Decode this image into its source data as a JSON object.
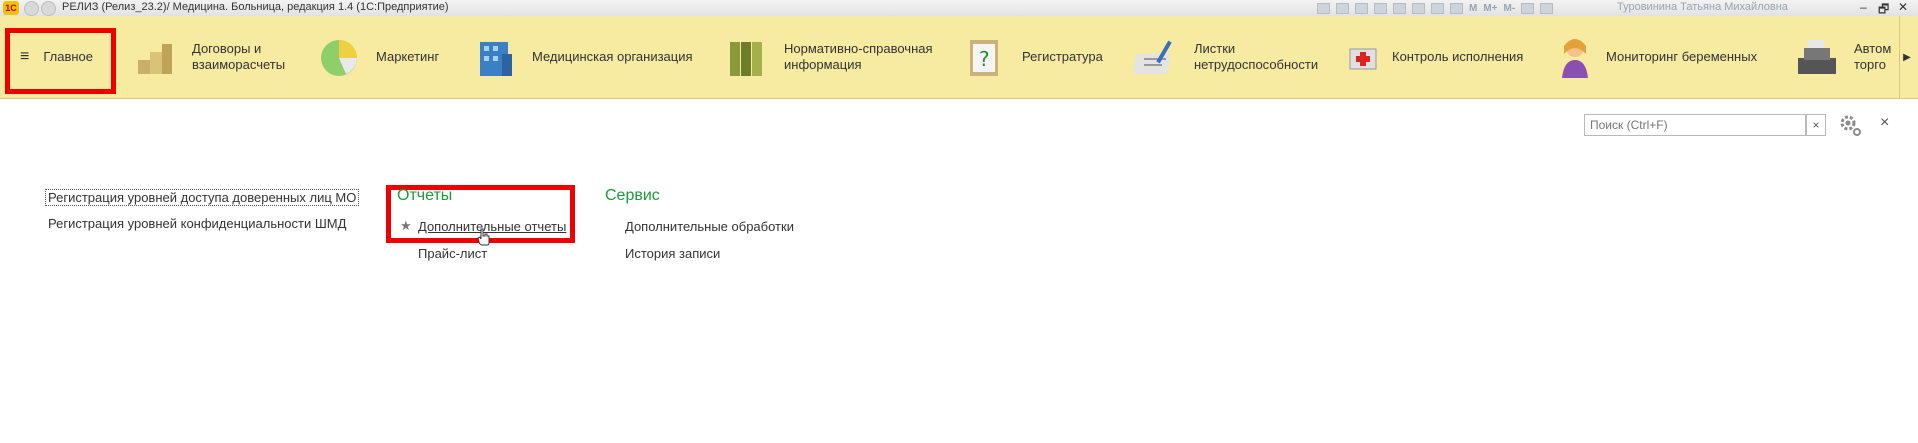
{
  "titlebar": {
    "logo": "1С",
    "title": "РЕЛИЗ (Релиз_23.2)/  Медицина. Больница, редакция 1.4  (1С:Предприятие)",
    "tool_labels": [
      "M",
      "M+",
      "M-"
    ],
    "user": "Туровинина Татьяна Михайловна",
    "window_controls": [
      "–",
      "🗗",
      "✕"
    ]
  },
  "sections": [
    {
      "label": "Главное",
      "icon": "menu-icon"
    },
    {
      "label": "Договоры и\nвзаиморасчеты",
      "icon": "coins-icon"
    },
    {
      "label": "Маркетинг",
      "icon": "pie-chart-icon"
    },
    {
      "label": "Медицинская организация",
      "icon": "building-icon"
    },
    {
      "label": "Нормативно-справочная\nинформация",
      "icon": "binders-icon"
    },
    {
      "label": "Регистратура",
      "icon": "clipboard-question-icon"
    },
    {
      "label": "Листки\nнетрудоспособности",
      "icon": "document-pen-icon"
    },
    {
      "label": "Контроль исполнения",
      "icon": "medical-kit-icon"
    },
    {
      "label": "Мониторинг беременных",
      "icon": "person-icon"
    },
    {
      "label": "Автом\nторго",
      "icon": "cash-register-icon"
    }
  ],
  "search": {
    "placeholder": "Поиск (Ctrl+F)",
    "clear": "×"
  },
  "close": "×",
  "content": {
    "left_links": [
      "Регистрация уровней доступа доверенных лиц МО",
      "Регистрация уровней конфиденциальности ШМД"
    ],
    "reports": {
      "title": "Отчеты",
      "items": [
        "Дополнительные отчеты",
        "Прайс-лист"
      ]
    },
    "service": {
      "title": "Сервис",
      "items": [
        "Дополнительные обработки",
        "История записи"
      ]
    }
  },
  "colors": {
    "section_bar": "#f7eaa1",
    "group_title": "#1b9a3a",
    "highlight": "#ee0000"
  }
}
